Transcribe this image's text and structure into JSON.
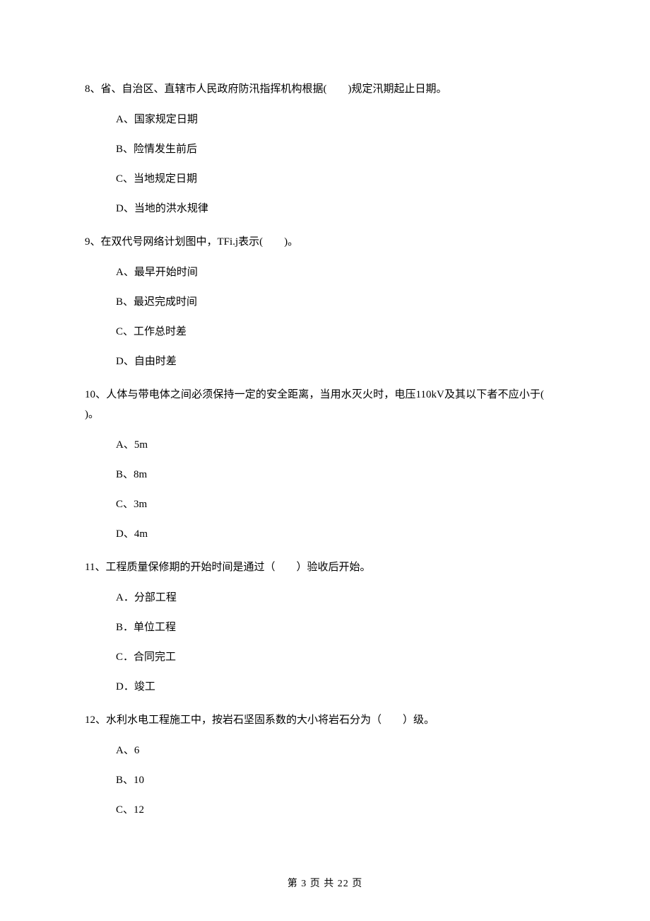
{
  "questions": [
    {
      "num": "8、",
      "text_pre": "省、自治区、直辖市人民政府防汛指挥机构根据(",
      "blank": "　　",
      "text_post": ")规定汛期起止日期。",
      "opts": [
        "A、国家规定日期",
        "B、险情发生前后",
        "C、当地规定日期",
        "D、当地的洪水规律"
      ]
    },
    {
      "num": "9、",
      "text_pre": "在双代号网络计划图中，TFi.j表示(",
      "blank": "　　",
      "text_post": ")。",
      "opts": [
        "A、最早开始时间",
        "B、最迟完成时间",
        "C、工作总时差",
        "D、自由时差"
      ]
    },
    {
      "num": "10、",
      "text_pre": "人体与带电体之间必须保持一定的安全距离，当用水灭火时，电压110kV及其以下者不应小于(",
      "blank": "　　",
      "text_post": ")。",
      "opts": [
        "A、5m",
        "B、8m",
        "C、3m",
        "D、4m"
      ]
    },
    {
      "num": "11、",
      "text_pre": "工程质量保修期的开始时间是通过（",
      "blank": "　　",
      "text_post": "）验收后开始。",
      "opts": [
        "A．分部工程",
        "B．单位工程",
        "C．合同完工",
        "D．竣工"
      ]
    },
    {
      "num": "12、",
      "text_pre": "水利水电工程施工中，按岩石坚固系数的大小将岩石分为（",
      "blank": "　　",
      "text_post": "）级。",
      "opts": [
        "A、6",
        "B、10",
        "C、12"
      ]
    }
  ],
  "footer": "第 3 页 共 22 页"
}
